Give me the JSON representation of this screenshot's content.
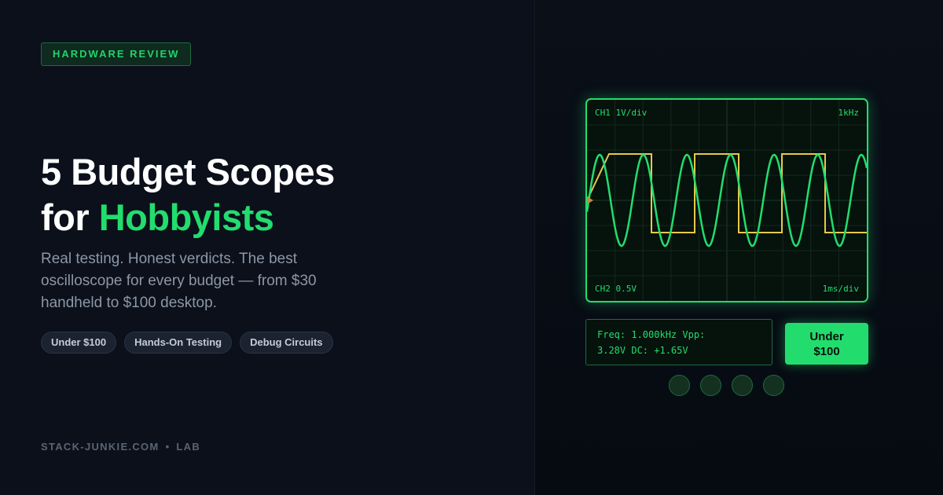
{
  "badge": "HARDWARE REVIEW",
  "headline": {
    "line1": "5 Budget Scopes",
    "line2_prefix": "for ",
    "line2_accent": "Hobbyists"
  },
  "subtitle": "Real testing. Honest verdicts. The best oscilloscope for every budget — from $30 handheld to $100 desktop.",
  "tags": [
    "Under $100",
    "Hands-On Testing",
    "Debug Circuits"
  ],
  "footer": {
    "site": "STACK-JUNKIE.COM",
    "separator": "•",
    "section": "LAB"
  },
  "scope": {
    "top_left": "CH1 1V/div",
    "top_right": "1kHz",
    "bottom_left": "CH2 0.5V",
    "bottom_right": "1ms/div",
    "trace_colors": {
      "sine": "#22dd6e",
      "square": "#e8c84a",
      "trigger": "#c98a3a"
    }
  },
  "readout": {
    "line1": "Freq: 1.000kHz  Vpp:",
    "line2": "3.28V  DC: +1.65V"
  },
  "price_button": {
    "line1": "Under",
    "line2": "$100"
  },
  "colors": {
    "accent": "#22dd6e",
    "background": "#0a0f1a"
  }
}
